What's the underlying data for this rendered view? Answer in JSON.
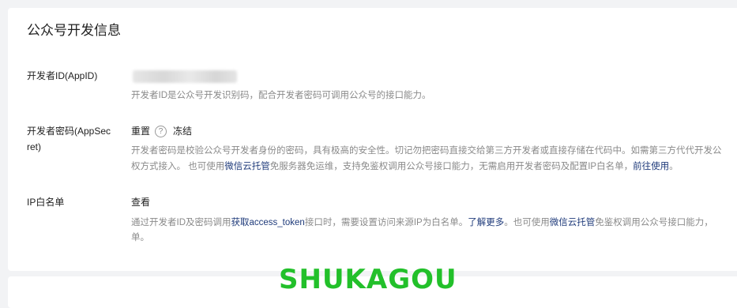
{
  "section": {
    "title": "公众号开发信息"
  },
  "appid": {
    "label": "开发者ID(AppID)",
    "desc": "开发者ID是公众号开发识别码，配合开发者密码可调用公众号的接口能力。"
  },
  "secret": {
    "label_line1": "开发者密码(AppSec",
    "label_line2": "ret)",
    "reset": "重置",
    "help": "?",
    "freeze": "冻结",
    "desc_line1": "开发者密码是校验公众号开发者身份的密码，具有极高的安全性。切记勿把密码直接交给第三方开发者或直接存储在代码中。如需第三方代代开发公",
    "desc_line2_a": "权方式接入。 也可使用",
    "desc_line2_link1": "微信云托管",
    "desc_line2_b": "免服务器免运维，支持免鉴权调用公众号接口能力，无需启用开发者密码及配置IP白名单，",
    "desc_line2_link2": "前往使用",
    "desc_line2_c": "。"
  },
  "ipwhitelist": {
    "label": "IP白名单",
    "view": "查看",
    "desc_line1_a": "通过开发者ID及密码调用",
    "desc_line1_link1": "获取access_token",
    "desc_line1_b": "接口时，需要设置访问来源IP为白名单。",
    "desc_line1_link2": "了解更多",
    "desc_line1_c": "。也可使用",
    "desc_line1_link3": "微信云托管",
    "desc_line1_d": "免鉴权调用公众号接口能力，",
    "desc_line2": "单。"
  },
  "watermark": "SHUKAGOU"
}
